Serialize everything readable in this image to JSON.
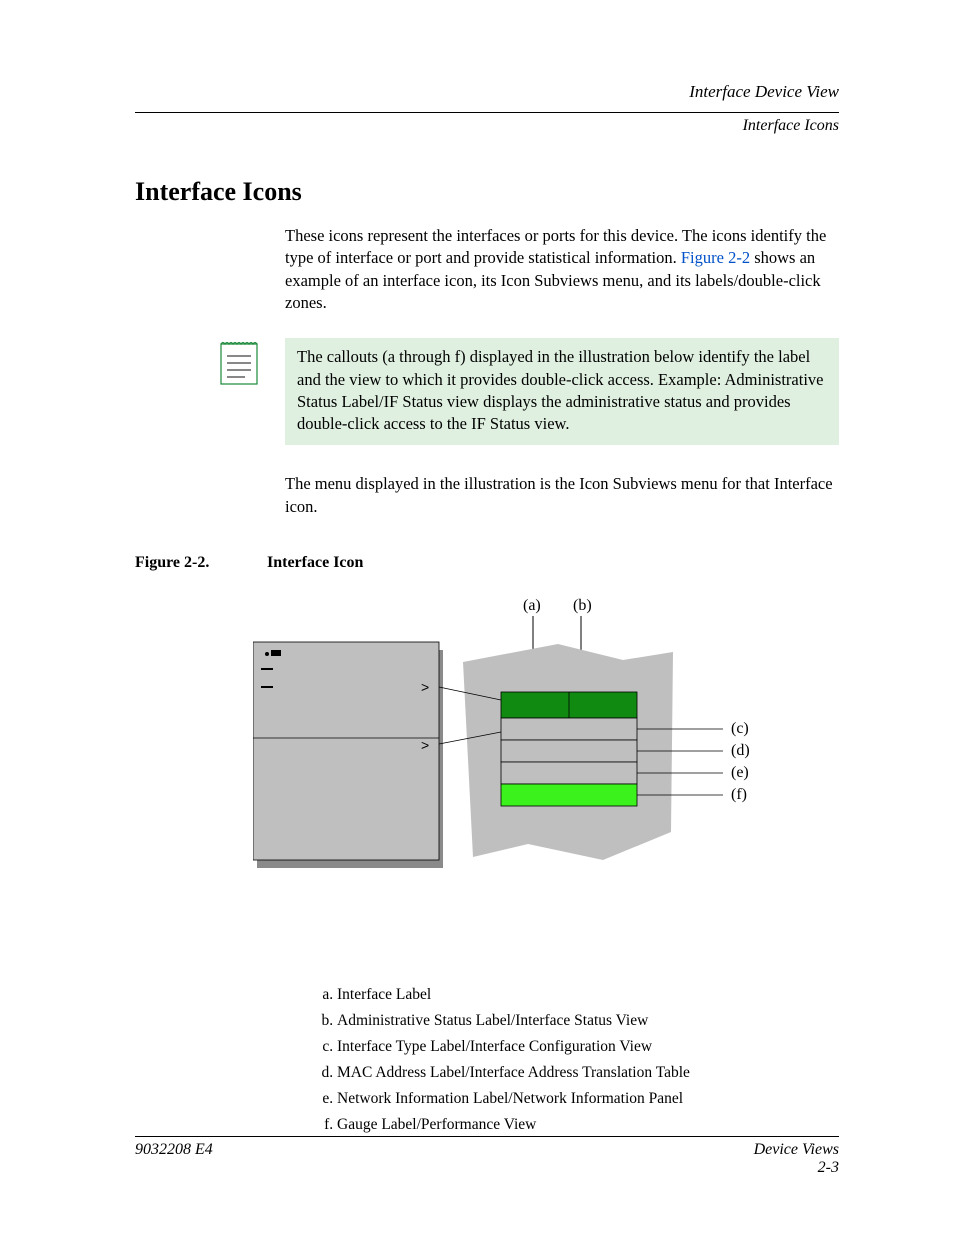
{
  "header": {
    "line1": "Interface Device View",
    "line2": "Interface Icons"
  },
  "section_title": "Interface Icons",
  "intro": {
    "part1": "These icons represent the interfaces or ports for this device. The icons identify the type of interface or port and provide statistical information. ",
    "link": "Figure 2-2",
    "part2": " shows an example of an interface icon, its Icon Subviews menu, and its labels/double-click zones."
  },
  "note": "The callouts (a through f) displayed in the illustration below identify the label and the view to which it provides double-click access. Example: Administrative Status Label/IF Status view displays the administrative status and provides double-click access to the IF Status view.",
  "after_note": "The menu displayed in the illustration is the Icon Subviews menu for that Interface icon.",
  "figure": {
    "label": "Figure 2-2.",
    "title": "Interface Icon",
    "callouts": {
      "a": "(a)",
      "b": "(b)",
      "c": "(c)",
      "d": "(d)",
      "e": "(e)",
      "f": "(f)"
    }
  },
  "legend": {
    "a": "Interface Label",
    "b": "Administrative Status Label/Interface Status View",
    "c": "Interface Type Label/Interface Configuration View",
    "d": "MAC Address Label/Interface Address Translation Table",
    "e": "Network Information Label/Network Information Panel",
    "f": "Gauge Label/Performance View"
  },
  "footer": {
    "doc_id": "9032208 E4",
    "right_title": "Device Views",
    "page_num": "2-3"
  },
  "colors": {
    "note_bg": "#dff0e0",
    "shadow": "#bfbfbf",
    "panel": "#bfbfbf",
    "dark_green": "#108a10",
    "bright_green": "#3cf21c"
  }
}
